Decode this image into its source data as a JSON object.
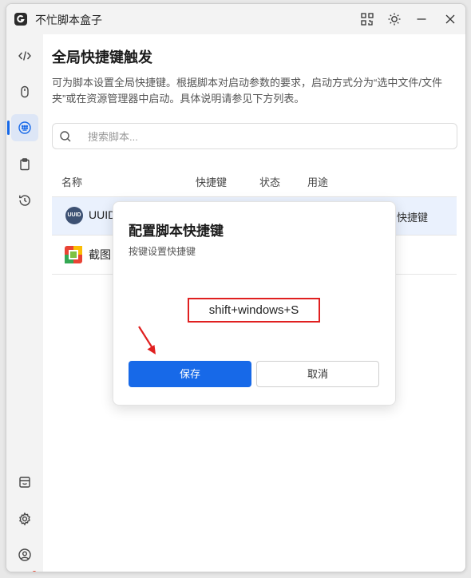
{
  "app": {
    "title": "不忙脚本盒子"
  },
  "page": {
    "title": "全局快捷键触发",
    "description": "可为脚本设置全局快捷键。根据脚本对启动参数的要求，启动方式分为“选中文件/文件夹”或在资源管理器中启动。具体说明请参见下方列表。"
  },
  "search": {
    "placeholder": "搜索脚本..."
  },
  "table": {
    "headers": {
      "name": "名称",
      "shortcut": "快捷键",
      "status": "状态",
      "usage": "用途"
    },
    "rows": [
      {
        "name": "UUID",
        "icon": "uuid-icon",
        "usage": "快捷键"
      },
      {
        "name": "截图",
        "icon": "screenshot-icon"
      }
    ]
  },
  "dialog": {
    "title": "配置脚本快捷键",
    "subtitle": "按键设置快捷键",
    "shortcut": "shift+windows+S",
    "save_label": "保存",
    "cancel_label": "取消"
  },
  "colors": {
    "accent": "#1769e8",
    "highlight": "#e02020",
    "selected_row": "#eaf1fd"
  }
}
